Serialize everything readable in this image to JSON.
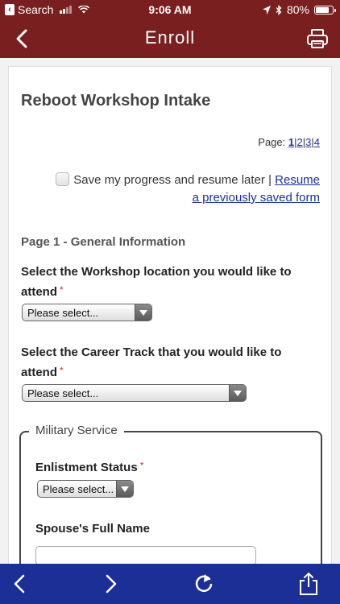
{
  "status_bar": {
    "carrier": "Search",
    "time": "9:06 AM",
    "battery": "80%",
    "battery_level": 0.8
  },
  "nav": {
    "title": "Enroll",
    "back_icon": "chevron-left-icon",
    "print_icon": "printer-icon"
  },
  "form": {
    "title": "Reboot Workshop Intake",
    "pager": {
      "label": "Page:",
      "pages": [
        "1",
        "2",
        "3",
        "4"
      ],
      "current": "1"
    },
    "save_progress": {
      "label": "Save my progress and resume later",
      "separator": "|",
      "resume_link": "Resume a previously saved form"
    },
    "section_header": "Page 1 - General Information",
    "questions": {
      "workshop_location": {
        "label": "Select the Workshop location you would like to attend",
        "required_marker": "*",
        "value": "Please select..."
      },
      "career_track": {
        "label": "Select the Career Track that you would like to attend",
        "required_marker": "*",
        "value": "Please select..."
      }
    },
    "military_service": {
      "legend": "Military Service",
      "enlistment_status": {
        "label": "Enlistment Status",
        "required_marker": "*",
        "value": "Please select..."
      },
      "spouse_name": {
        "label": "Spouse's Full Name",
        "value": ""
      }
    }
  },
  "toolbar": {
    "back_icon": "chevron-left-icon",
    "forward_icon": "chevron-right-icon",
    "reload_icon": "reload-icon",
    "share_icon": "share-icon"
  },
  "colors": {
    "header": "#7a1f1f",
    "toolbar": "#1c2f96",
    "link": "#1a2fa8",
    "required": "#c0392b"
  }
}
